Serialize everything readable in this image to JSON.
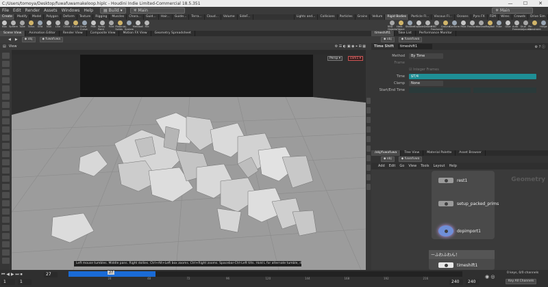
{
  "window": {
    "title": "C:/Users/tomoya/Desktop/fuwafuwamakeloop.hiplc - Houdini Indie Limited-Commercial 18.5.351",
    "minimize_glyph": "—",
    "maximize_glyph": "☐",
    "close_glyph": "✕"
  },
  "menubar": {
    "items": [
      "File",
      "Edit",
      "Render",
      "Assets",
      "Windows",
      "Help"
    ],
    "build_label": "Build",
    "desktop_label": "Main",
    "right_desktop_label": "Main"
  },
  "shelf_tabs_left": [
    "Create",
    "Modify",
    "Model",
    "Polygon",
    "Deform",
    "Texture",
    "Rigging",
    "Muscles",
    "Chara...",
    "Guid...",
    "Hair...",
    "Guide...",
    "Terra...",
    "Cloud...",
    "Volume",
    "SideF..."
  ],
  "shelf_tabs_right": [
    "Lights and...",
    "Collisions",
    "Particles",
    "Grains",
    "Vellum",
    "Rigid Bodies",
    "Particle Fl...",
    "Viscous Fl...",
    "Oceans",
    "Pyro FX",
    "FEM",
    "Wires",
    "Crowds",
    "Drive Sim"
  ],
  "tools_left": [
    "Box",
    "Sphere",
    "Tube",
    "Torus",
    "Grid",
    "Null",
    "Line",
    "Circle",
    "Curve",
    "Draw Curve",
    "Path",
    "Spray Paint",
    "Font",
    "Platonic Solids",
    "L-System",
    "Metaball",
    "File"
  ],
  "tools_right": [
    "RBD Objects",
    "Hero Object",
    "Shatter",
    "Explode",
    "Debris",
    "RBD Fractured",
    "Ground",
    "Conform",
    "Pack",
    "Fracture",
    "Voronoi",
    "Ragdoll",
    "Fuse",
    "Glue",
    "Auto Freeze",
    "Glue Adjacent",
    "Pin Constraint",
    "Hinge"
  ],
  "left_pane_tabs": [
    "Scene View",
    "Animation Editor",
    "Render View",
    "Composite View",
    "Motion FX View",
    "Geometry Spreadsheet"
  ],
  "left_path": [
    "obj",
    "fuwafuwa"
  ],
  "viewport": {
    "label": "View",
    "persp_label": "Persp ▾",
    "cam_label": "cam1 ▾"
  },
  "hint_text": "Left mouse tumbles. Middle pans. Right dollies. Ctrl+Alt+Left box zooms. Ctrl+Right zooms. Spacebar-Ctrl-Left tilts. Hold L for alternate tumble, dolly, and zoom.",
  "right_top_tabs": [
    "timeshift1",
    "Take List",
    "Performance Monitor"
  ],
  "right_path": [
    "obj",
    "fuwafuwa"
  ],
  "params": {
    "node_type": "Time Shift",
    "node_name": "timeshift1",
    "method_label": "Method",
    "method_value": "By Time",
    "frame_label": "Frame",
    "integer_frames_label": "Integer Frames",
    "time_label": "Time",
    "time_value": "$T/4",
    "clamp_label": "Clamp",
    "clamp_value": "None",
    "startend_label": "Start/End Time"
  },
  "network_tabs": [
    "/obj/fuwafuwa",
    "Tree View",
    "Material Palette",
    "Asset Browser"
  ],
  "network_path": [
    "obj",
    "fuwafuwa"
  ],
  "network_menu": [
    "Add",
    "Edit",
    "Go",
    "View",
    "Tools",
    "Layout",
    "Help"
  ],
  "network_context": "Geometry",
  "nodes": [
    "rest1",
    "setup_packed_prims",
    "dopimport1",
    "timeshift1"
  ],
  "sticky_note": "ーふわふわん！",
  "timeline": {
    "current_frame": "27",
    "start_frame": "1",
    "end_frame": "240",
    "end_frame2": "240",
    "ticks": [
      "24",
      "48",
      "72",
      "96",
      "120",
      "144",
      "168",
      "192",
      "216"
    ],
    "marker": "27",
    "keys_label": "0 keys, 0/0 channels",
    "key_all_label": "Key All Channels"
  },
  "colors": {
    "accent_teal": "#1e8f96",
    "dop_node": "#6f8fd8",
    "timeline_bar": "#1a6bd6"
  }
}
